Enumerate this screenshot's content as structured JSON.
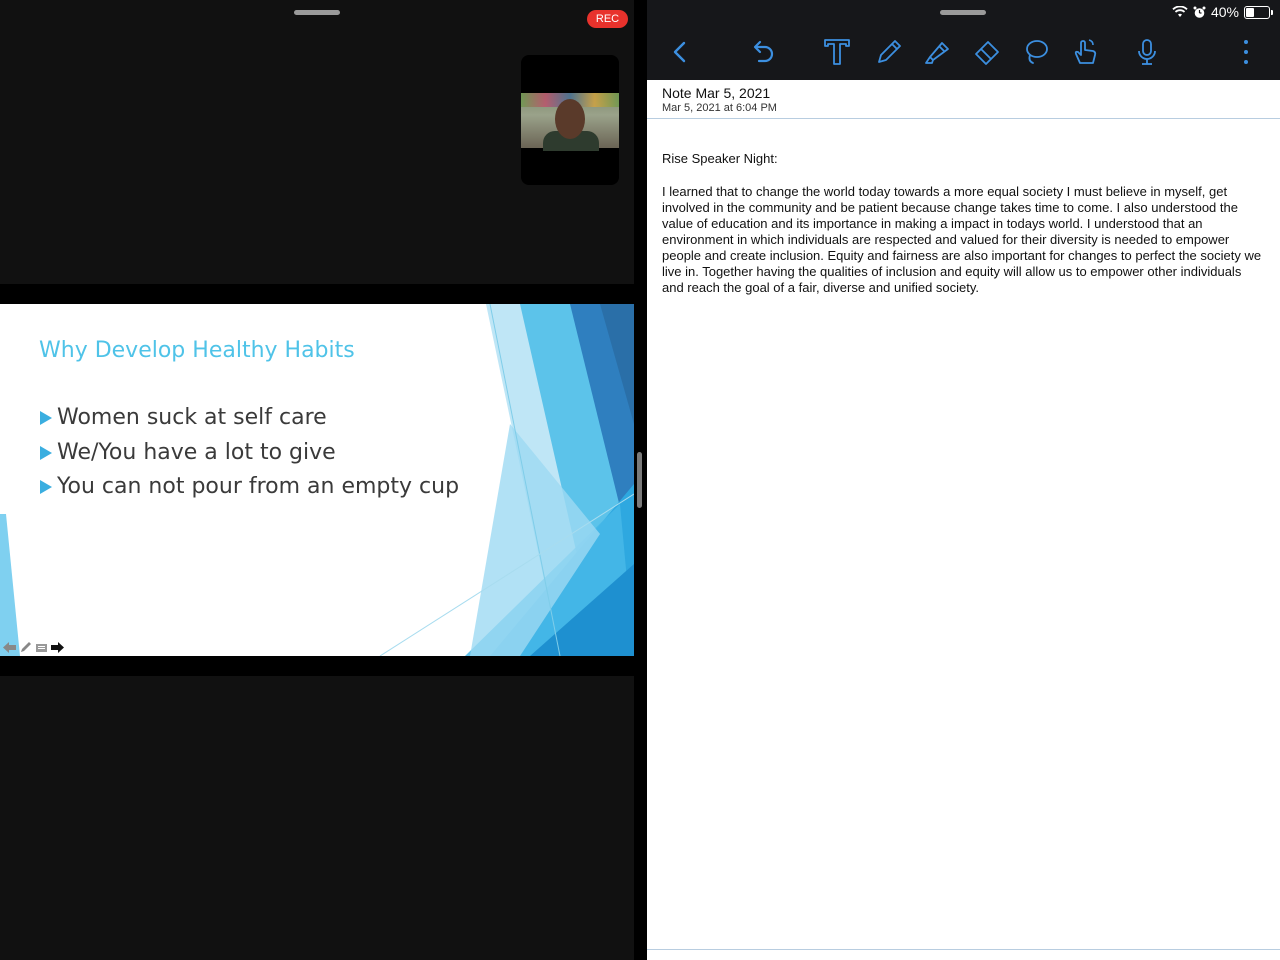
{
  "meeting": {
    "rec_label": "REC"
  },
  "slide": {
    "title": "Why Develop Healthy Habits",
    "bullets": [
      "Women suck at self care",
      "We/You have a lot to give",
      "You can not pour from an empty cup"
    ],
    "colors": {
      "title": "#4fc3e8",
      "accent": "#3aaee0"
    }
  },
  "status_bar": {
    "battery_text": "40%",
    "battery_level": 0.4
  },
  "toolbar": {
    "icons": [
      "back-icon",
      "undo-icon",
      "text-tool-icon",
      "pencil-icon",
      "highlighter-icon",
      "eraser-icon",
      "lasso-icon",
      "hand-gesture-icon",
      "microphone-icon",
      "more-menu-icon"
    ],
    "accent": "#3c8fe0"
  },
  "note": {
    "title": "Note Mar 5, 2021",
    "date": "Mar 5, 2021 at 6:04 PM",
    "heading": "Rise Speaker Night:",
    "body": "I learned that to change the world today towards a more equal society I must believe in myself, get involved in the community and be patient because change takes time to come. I also understood the value of education and its importance in making a impact in todays world. I understood that an environment in which individuals are respected and valued for their diversity is needed to empower people and create inclusion. Equity and fairness are also important for changes to perfect the society we live in. Together having the qualities of inclusion and equity will allow us to empower other individuals and reach the goal of a fair, diverse and unified society."
  }
}
